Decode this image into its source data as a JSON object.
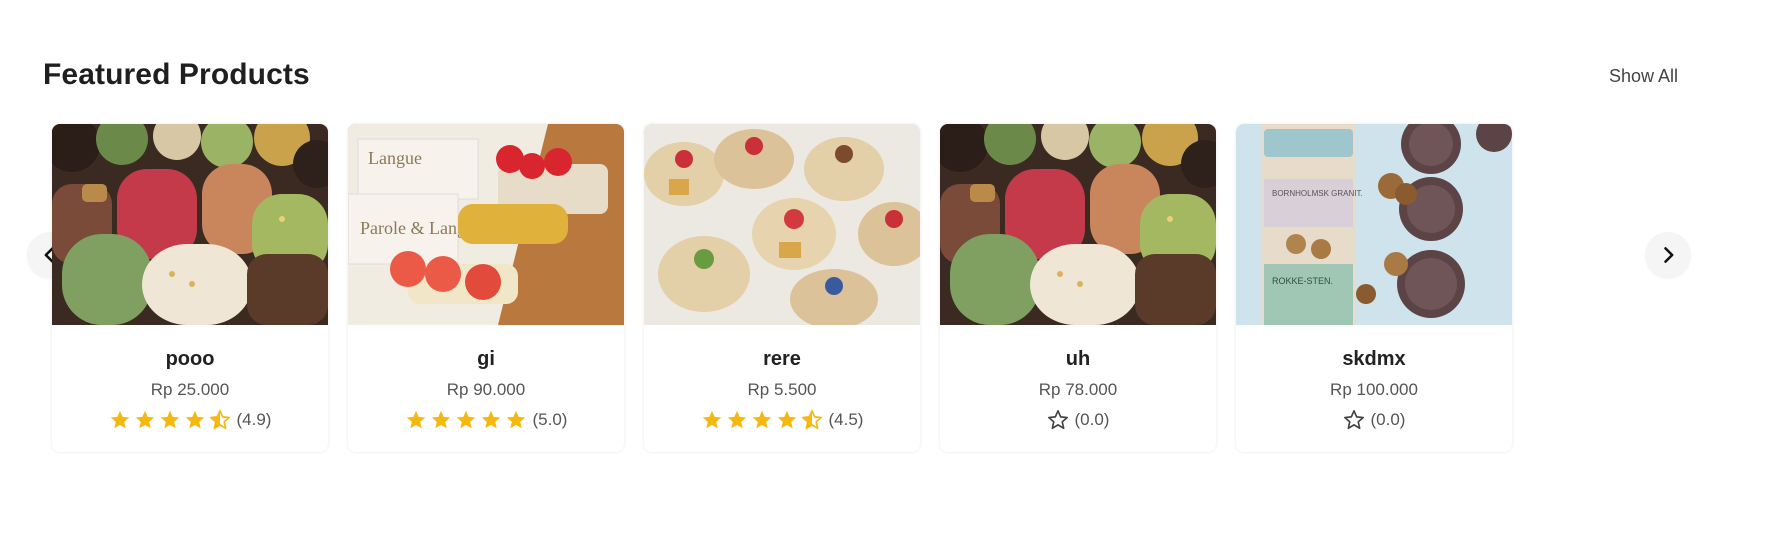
{
  "section": {
    "title": "Featured Products",
    "show_all": "Show All"
  },
  "products": [
    {
      "name": "pooo",
      "price": "Rp 25.000",
      "rating": 4.9,
      "rating_label": "(4.9)",
      "image": "loaf-cakes-photo"
    },
    {
      "name": "gi",
      "price": "Rp 90.000",
      "rating": 5.0,
      "rating_label": "(5.0)",
      "image": "parole-langue-pastries-photo"
    },
    {
      "name": "rere",
      "price": "Rp 5.500",
      "rating": 4.5,
      "rating_label": "(4.5)",
      "image": "waffle-tarts-photo"
    },
    {
      "name": "uh",
      "price": "Rp 78.000",
      "rating": 0,
      "rating_label": "(0.0)",
      "image": "loaf-cakes-photo"
    },
    {
      "name": "skdmx",
      "price": "Rp 100.000",
      "rating": 0,
      "rating_label": "(0.0)",
      "image": "cookie-jars-photo"
    }
  ],
  "jar_labels": [
    "BORNHOLMSK GRANIT.",
    "ROKKE-STEN."
  ],
  "box_labels": [
    "Parole & Langue",
    "Langue"
  ],
  "navigation": {
    "prev_icon": "chevron-left-icon",
    "next_icon": "chevron-right-icon"
  },
  "colors": {
    "star_filled": "#f5b80f",
    "star_empty": "#444444",
    "nav_bg": "#f5f5f5"
  }
}
